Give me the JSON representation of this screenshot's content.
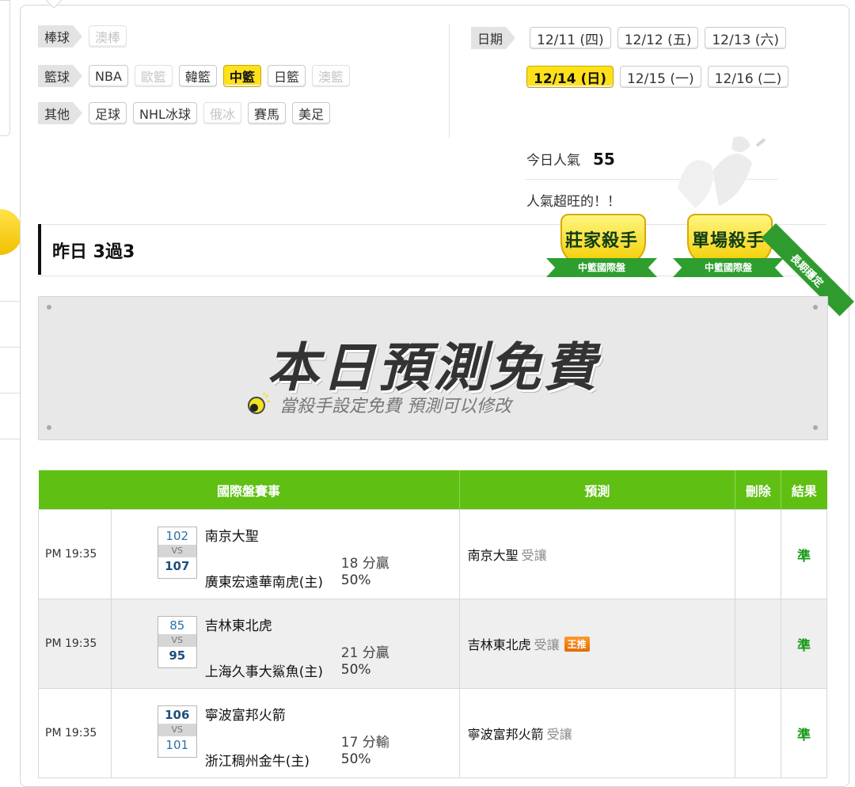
{
  "sports": {
    "rows": [
      {
        "category": "棒球",
        "items": [
          {
            "label": "澳棒",
            "state": "disabled"
          }
        ]
      },
      {
        "category": "籃球",
        "items": [
          {
            "label": "NBA",
            "state": "normal"
          },
          {
            "label": "歐籃",
            "state": "disabled"
          },
          {
            "label": "韓籃",
            "state": "normal"
          },
          {
            "label": "中籃",
            "state": "active"
          },
          {
            "label": "日籃",
            "state": "normal"
          },
          {
            "label": "澳籃",
            "state": "disabled"
          }
        ]
      },
      {
        "category": "其他",
        "items": [
          {
            "label": "足球",
            "state": "normal"
          },
          {
            "label": "NHL冰球",
            "state": "normal"
          },
          {
            "label": "俄冰",
            "state": "disabled"
          },
          {
            "label": "賽馬",
            "state": "normal"
          },
          {
            "label": "美足",
            "state": "normal"
          }
        ]
      }
    ]
  },
  "dates": {
    "label": "日期",
    "row1": [
      "12/11 (四)",
      "12/12 (五)",
      "12/13 (六)"
    ],
    "row2": [
      "12/14 (日)",
      "12/15 (一)",
      "12/16 (二)"
    ],
    "active": "12/14 (日)"
  },
  "popularity": {
    "label": "今日人氣",
    "count": "55",
    "tagline": "人氣超旺的！！"
  },
  "yesterday": {
    "text": "昨日 3過3"
  },
  "badges": [
    {
      "title": "莊家殺手",
      "sub": "中籃國際盤"
    },
    {
      "title": "單場殺手",
      "sub": "中籃國際盤"
    }
  ],
  "long_ribbon": "長期穩定",
  "free_banner": {
    "title": "本日預測免費",
    "subtitle": "當殺手設定免費 預測可以修改"
  },
  "table": {
    "headers": {
      "match": "國際盤賽事",
      "prediction": "預測",
      "delete": "刪除",
      "result": "結果"
    },
    "rows": [
      {
        "time": "PM 19:35",
        "away_score": "102",
        "home_score": "107",
        "bold": "home",
        "vs": "VS",
        "away": "南京大聖",
        "home": "廣東宏遠華南虎(主)",
        "spread": "18 分贏",
        "pct": "50%",
        "pick": "南京大聖",
        "pick_note": "受讓",
        "king": "",
        "result": "準"
      },
      {
        "time": "PM 19:35",
        "away_score": "85",
        "home_score": "95",
        "bold": "home",
        "vs": "VS",
        "away": "吉林東北虎",
        "home": "上海久事大鯊魚(主)",
        "spread": "21 分贏",
        "pct": "50%",
        "pick": "吉林東北虎",
        "pick_note": "受讓",
        "king": "王推",
        "result": "準"
      },
      {
        "time": "PM 19:35",
        "away_score": "106",
        "home_score": "101",
        "bold": "away",
        "vs": "VS",
        "away": "寧波富邦火箭",
        "home": "浙江稠州金牛(主)",
        "spread": "17 分輸",
        "pct": "50%",
        "pick": "寧波富邦火箭",
        "pick_note": "受讓",
        "king": "",
        "result": "準"
      }
    ]
  }
}
